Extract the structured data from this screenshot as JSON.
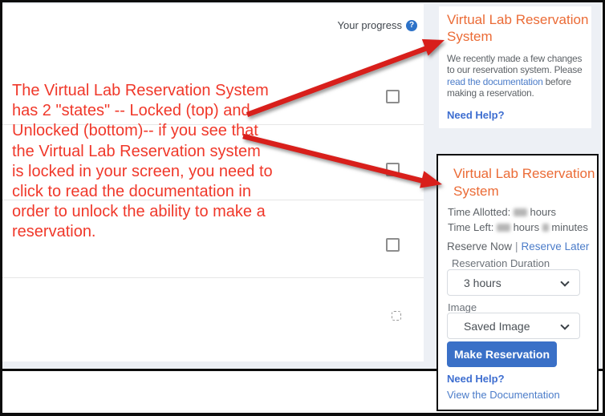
{
  "page": {
    "progress_label": "Your progress",
    "help_glyph": "?"
  },
  "annotation": {
    "text": "The Virtual Lab Reservation System\nhas 2 \"states\" -- Locked (top) and\nUnlocked (bottom)-- if you see that\nthe Virtual Lab Reservation system\nis locked in your screen, you need to\nclick to read the documentation in\norder to unlock the ability to make a\nreservation.",
    "color": "#f0382a"
  },
  "cards": {
    "locked": {
      "title": "Virtual Lab Reservation System",
      "body_pre": "We recently made a few changes to our reservation system. Please ",
      "body_link": "read the documentation",
      "body_post": " before making a reservation.",
      "help": "Need Help?"
    },
    "unlocked": {
      "title": "Virtual Lab Reservation System",
      "time_allotted_label": "Time Allotted:",
      "time_allotted_unit": "hours",
      "time_left_label": "Time Left:",
      "time_left_hours_unit": "hours",
      "time_left_minutes_unit": "minutes",
      "reserve_now": "Reserve Now",
      "separator": "|",
      "reserve_later": "Reserve Later",
      "duration_label": "Reservation Duration",
      "duration_value": "3 hours",
      "image_label": "Image",
      "image_value": "Saved Image",
      "button": "Make Reservation",
      "help": "Need Help?",
      "view_doc": "View the Documentation"
    }
  },
  "colors": {
    "accent_orange": "#eb6b36",
    "link_blue": "#4b7cc9",
    "button_blue": "#3a70c7",
    "annotation_red": "#f0382a",
    "arrow_red": "#d81f1b",
    "sidebar_gray": "#edf0f5"
  }
}
